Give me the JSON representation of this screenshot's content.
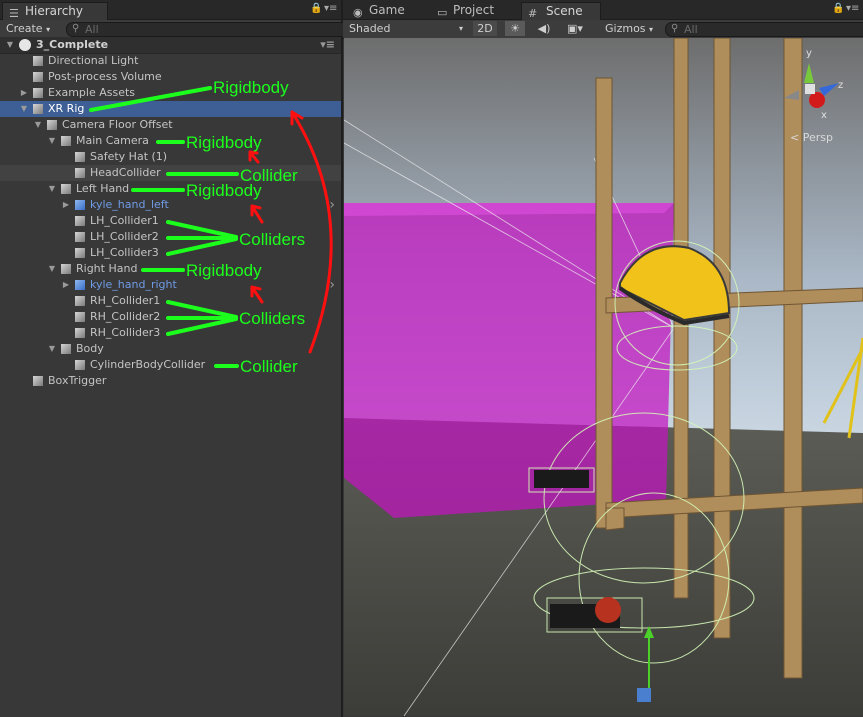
{
  "hierarchy": {
    "tab_label": "Hierarchy",
    "create_label": "Create",
    "search_placeholder": "All",
    "scene_name": "3_Complete",
    "items": [
      {
        "label": "Directional Light",
        "depth": 1,
        "arrow": "",
        "prefab": false
      },
      {
        "label": "Post-process Volume",
        "depth": 1,
        "arrow": "",
        "prefab": false
      },
      {
        "label": "Example Assets",
        "depth": 1,
        "arrow": "right",
        "prefab": false
      },
      {
        "label": "XR Rig",
        "depth": 1,
        "arrow": "down",
        "prefab": false,
        "selected": true
      },
      {
        "label": "Camera Floor Offset",
        "depth": 2,
        "arrow": "down",
        "prefab": false
      },
      {
        "label": "Main Camera",
        "depth": 3,
        "arrow": "down",
        "prefab": false
      },
      {
        "label": "Safety Hat (1)",
        "depth": 4,
        "arrow": "",
        "prefab": false
      },
      {
        "label": "HeadCollider",
        "depth": 4,
        "arrow": "",
        "prefab": false,
        "highlight": true
      },
      {
        "label": "Left Hand",
        "depth": 3,
        "arrow": "down",
        "prefab": false
      },
      {
        "label": "kyle_hand_left",
        "depth": 4,
        "arrow": "right",
        "prefab": true,
        "more": true
      },
      {
        "label": "LH_Collider1",
        "depth": 4,
        "arrow": "",
        "prefab": false
      },
      {
        "label": "LH_Collider2",
        "depth": 4,
        "arrow": "",
        "prefab": false
      },
      {
        "label": "LH_Collider3",
        "depth": 4,
        "arrow": "",
        "prefab": false
      },
      {
        "label": "Right Hand",
        "depth": 3,
        "arrow": "down",
        "prefab": false
      },
      {
        "label": "kyle_hand_right",
        "depth": 4,
        "arrow": "right",
        "prefab": true,
        "more": true
      },
      {
        "label": "RH_Collider1",
        "depth": 4,
        "arrow": "",
        "prefab": false
      },
      {
        "label": "RH_Collider2",
        "depth": 4,
        "arrow": "",
        "prefab": false
      },
      {
        "label": "RH_Collider3",
        "depth": 4,
        "arrow": "",
        "prefab": false
      },
      {
        "label": "Body",
        "depth": 3,
        "arrow": "down",
        "prefab": false
      },
      {
        "label": "CylinderBodyCollider",
        "depth": 4,
        "arrow": "",
        "prefab": false
      },
      {
        "label": "BoxTrigger",
        "depth": 1,
        "arrow": "",
        "prefab": false
      }
    ]
  },
  "annotations": {
    "rigidbody": "Rigidbody",
    "collider": "Collider",
    "colliders": "Colliders"
  },
  "scene_tabs": {
    "game": "Game",
    "project": "Project",
    "scene": "Scene"
  },
  "scene_toolbar": {
    "shading": "Shaded",
    "mode_2d": "2D",
    "gizmos": "Gizmos",
    "search_placeholder": "All"
  },
  "gizmo": {
    "persp_label": "Persp",
    "axis_y": "y",
    "axis_x": "x",
    "axis_z": "z"
  },
  "colors": {
    "selection": "#3e5f96",
    "prefab_text": "#6f9be6",
    "annotation_green": "#1cff1c",
    "annotation_red": "#ff1010"
  }
}
